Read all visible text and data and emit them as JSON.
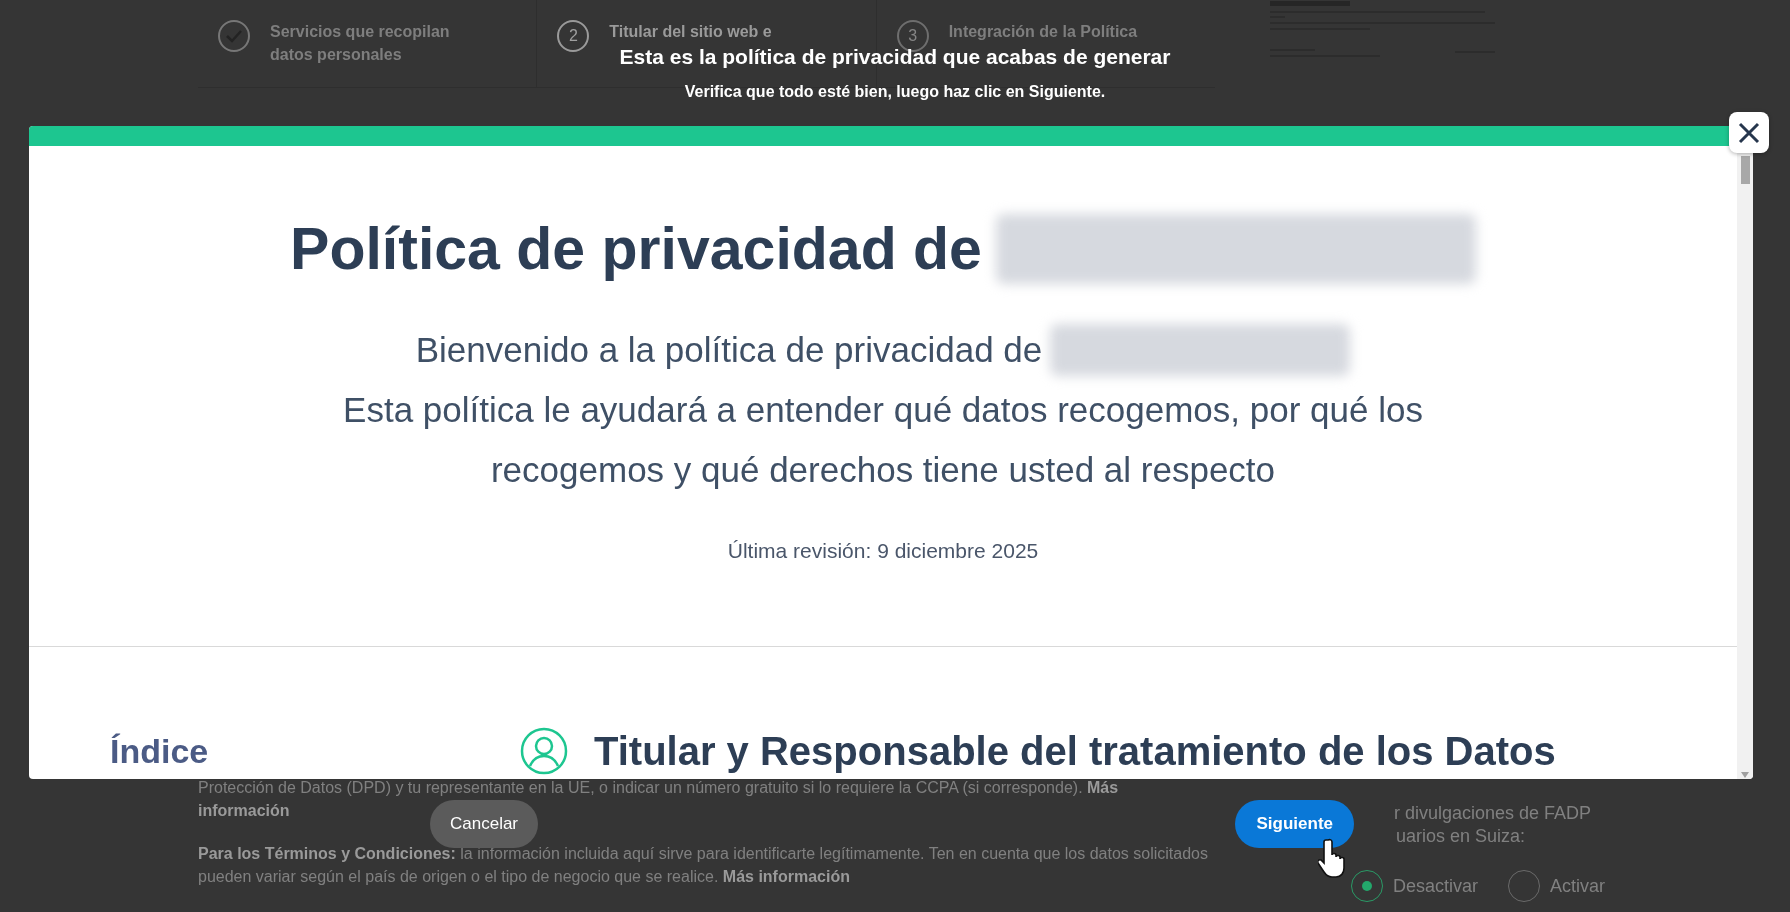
{
  "background_page": {
    "steps": [
      {
        "label": "Servicios que recopilan datos personales",
        "kind": "done"
      },
      {
        "number": "2",
        "label": "Titular del sitio web e",
        "kind": "current"
      },
      {
        "number": "3",
        "label": "Integración de la Política",
        "kind": "upcoming"
      }
    ],
    "notes": [
      "Protección de Datos (DPD) y tu representante en la UE, o indicar un número gratuito si lo requiere la CCPA (si corresponde). **Más información**",
      "**Para los Términos y Condiciones:** la información incluida aquí sirve para identificarte legítimamente. Ten en cuenta que los datos solicitados pueden variar según el país de origen o el tipo de negocio que se realice. **Más información**"
    ],
    "fadp_setting": {
      "label_lines": [
        "r divulgaciones de FADP",
        "uarios en Suiza:"
      ],
      "options": [
        {
          "label": "Desactivar",
          "selected": true
        },
        {
          "label": "Activar",
          "selected": false
        }
      ]
    }
  },
  "overlay": {
    "title": "Esta es la política de privacidad que acabas de generar",
    "subtitle": "Verifica que todo esté bien, luego haz clic en Siguiente."
  },
  "modal": {
    "heading": "Política de privacidad de",
    "intro_lead": "Bienvenido a la política de privacidad de",
    "intro_rest": "Esta política le ayudará a entender qué datos recogemos, por qué los recogemos y qué derechos tiene usted al respecto",
    "last_revised": "Última revisión: 9 diciembre 2025",
    "index_title": "Índice",
    "section_title": "Titular y Responsable del tratamiento de los Datos"
  },
  "buttons": [
    {
      "label": "Cancelar",
      "kind": "secondary"
    },
    {
      "label": "Siguiente",
      "kind": "primary"
    }
  ]
}
